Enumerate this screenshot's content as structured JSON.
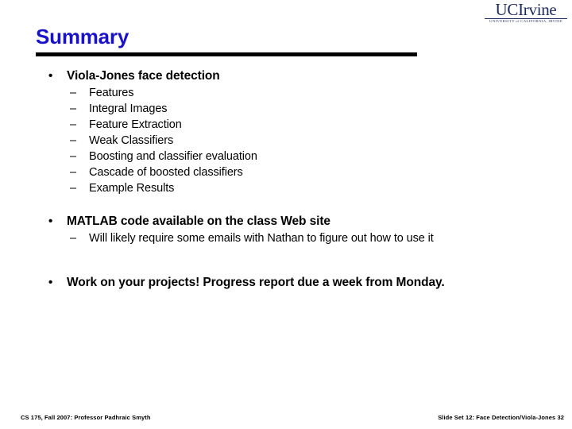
{
  "slide": {
    "title": "Summary",
    "title_color": "#1a12c8",
    "rule_color": "#000000",
    "background": "#ffffff"
  },
  "logo": {
    "wordmark": "UCIrvine",
    "subtitle": "UNIVERSITY of CALIFORNIA, IRVINE",
    "color": "#1d2a5c"
  },
  "markers": {
    "level1": "•",
    "level2": "–"
  },
  "content": {
    "blocks": [
      {
        "heading": "Viola-Jones face detection",
        "items": [
          "Features",
          "Integral Images",
          "Feature Extraction",
          "Weak Classifiers",
          "Boosting and classifier evaluation",
          "Cascade of boosted classifiers",
          "Example Results"
        ]
      },
      {
        "heading": "MATLAB code available on the class Web site",
        "items": [
          "Will likely require some emails with Nathan to figure out how to use it"
        ]
      },
      {
        "heading": "Work on your projects! Progress report due a week from Monday.",
        "items": []
      }
    ]
  },
  "footer": {
    "left": "CS 175, Fall 2007: Professor Padhraic Smyth",
    "right": "Slide Set 12: Face Detection/Viola-Jones 32"
  }
}
